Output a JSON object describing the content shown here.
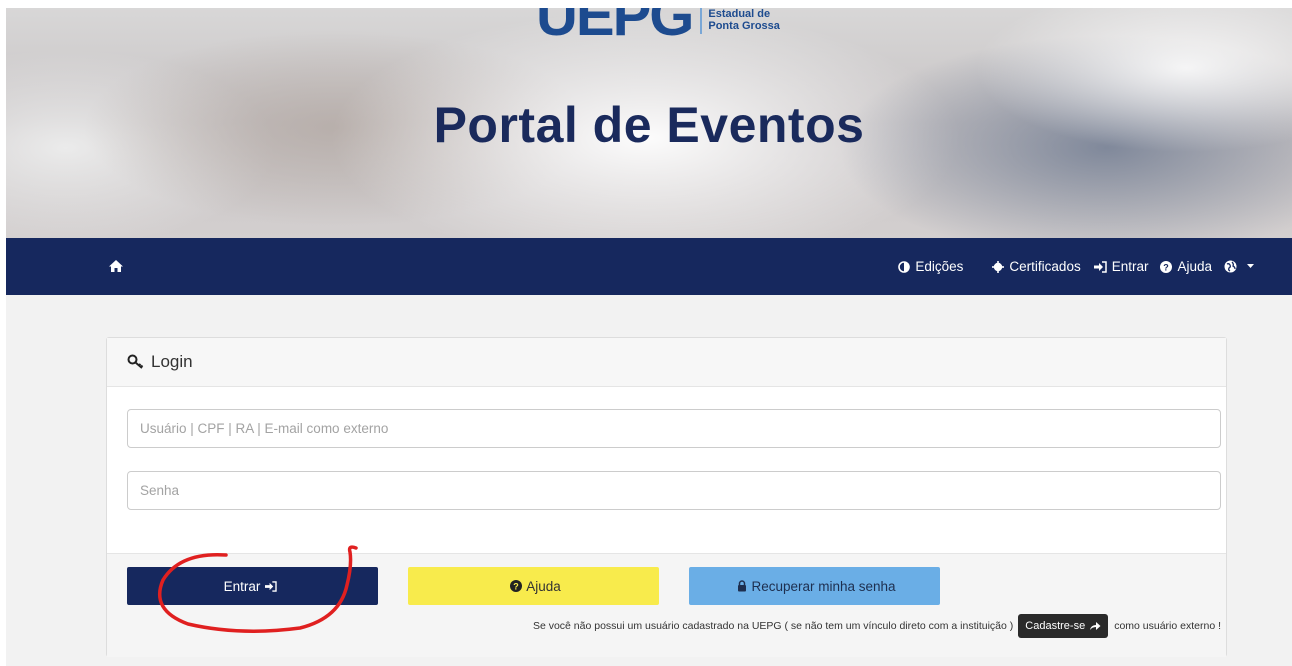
{
  "banner": {
    "logo_mark": "UEPG",
    "logo_line1": "Estadual de",
    "logo_line2": "Ponta Grossa",
    "title": "Portal de Eventos"
  },
  "navbar": {
    "home_icon": "home-icon",
    "items": [
      {
        "label": "Edições",
        "icon": "half-circle-icon"
      },
      {
        "label": "Certificados",
        "icon": "certificate-icon"
      },
      {
        "label": "Entrar",
        "icon": "sign-in-icon"
      },
      {
        "label": "Ajuda",
        "icon": "question-circle-icon"
      }
    ],
    "language_icon": "globe-icon"
  },
  "login": {
    "heading": "Login",
    "heading_icon": "key-icon",
    "username_placeholder": "Usuário | CPF | RA | E-mail como externo",
    "username_value": "",
    "password_placeholder": "Senha",
    "password_value": "",
    "buttons": {
      "entrar": "Entrar",
      "ajuda": "Ajuda",
      "recuperar": "Recuperar minha senha"
    },
    "footer_text_before": "Se você não possui um usuário cadastrado na UEPG ( se não tem um vínculo direto com a instituição )",
    "cadastre_label": "Cadastre-se",
    "footer_text_after": "como usuário externo !"
  },
  "colors": {
    "navy": "#16285e",
    "yellow": "#f8eb4c",
    "light_blue": "#6aaee6",
    "annotation_red": "#e02020"
  }
}
